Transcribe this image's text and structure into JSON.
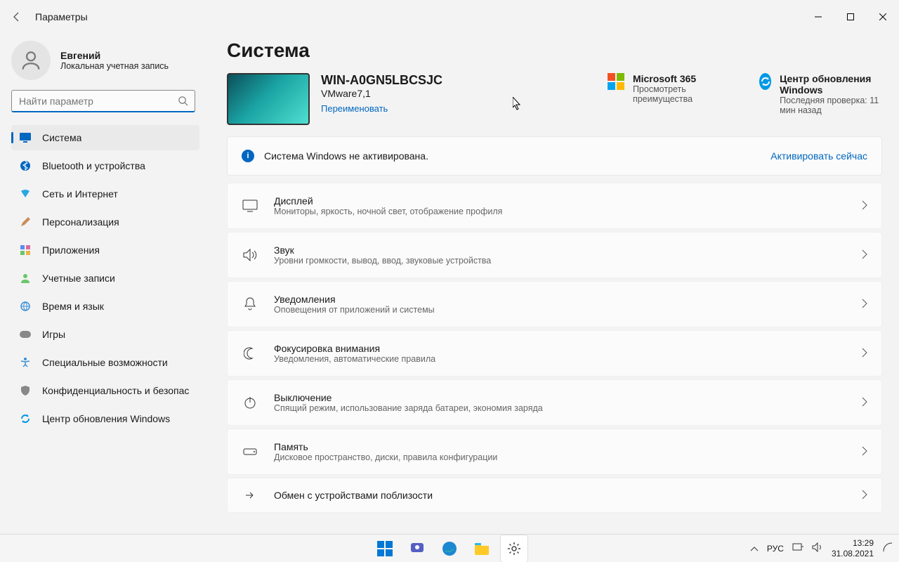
{
  "titlebar": {
    "back": "←",
    "title": "Параметры"
  },
  "user": {
    "name": "Евгений",
    "sub": "Локальная учетная запись"
  },
  "search": {
    "placeholder": "Найти параметр"
  },
  "nav": [
    {
      "label": "Система",
      "active": true
    },
    {
      "label": "Bluetooth и устройства"
    },
    {
      "label": "Сеть и Интернет"
    },
    {
      "label": "Персонализация"
    },
    {
      "label": "Приложения"
    },
    {
      "label": "Учетные записи"
    },
    {
      "label": "Время и язык"
    },
    {
      "label": "Игры"
    },
    {
      "label": "Специальные возможности"
    },
    {
      "label": "Конфиденциальность и безопасность"
    },
    {
      "label": "Центр обновления Windows"
    }
  ],
  "page": {
    "title": "Система",
    "device": {
      "name": "WIN-A0GN5LBCSJC",
      "model": "VMware7,1",
      "rename": "Переименовать"
    },
    "ms365": {
      "title": "Microsoft 365",
      "sub": "Просмотреть преимущества"
    },
    "update": {
      "title": "Центр обновления Windows",
      "sub": "Последняя проверка: 11 мин назад"
    },
    "banner": {
      "text": "Система Windows не активирована.",
      "action": "Активировать сейчас"
    },
    "items": [
      {
        "title": "Дисплей",
        "sub": "Мониторы, яркость, ночной свет, отображение профиля"
      },
      {
        "title": "Звук",
        "sub": "Уровни громкости, вывод, ввод, звуковые устройства"
      },
      {
        "title": "Уведомления",
        "sub": "Оповещения от приложений и системы"
      },
      {
        "title": "Фокусировка внимания",
        "sub": "Уведомления, автоматические правила"
      },
      {
        "title": "Выключение",
        "sub": "Спящий режим, использование заряда батареи, экономия заряда"
      },
      {
        "title": "Память",
        "sub": "Дисковое пространство, диски, правила конфигурации"
      },
      {
        "title": "Обмен с устройствами поблизости",
        "sub": ""
      }
    ]
  },
  "taskbar": {
    "tray": {
      "lang": "РУС",
      "time": "13:29",
      "date": "31.08.2021"
    }
  }
}
